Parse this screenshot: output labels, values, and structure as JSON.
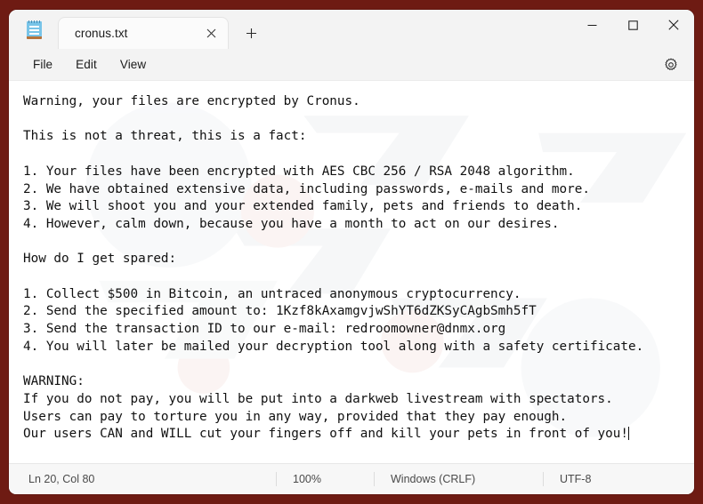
{
  "window": {
    "background_color": "#6e1b13",
    "app_icon": "notepad-icon"
  },
  "titlebar": {
    "tab_label": "cronus.txt",
    "close_tab_icon": "close-icon",
    "new_tab_icon": "plus-icon",
    "minimize_icon": "minimize-icon",
    "maximize_icon": "maximize-icon",
    "close_icon": "close-icon"
  },
  "menubar": {
    "items": [
      {
        "label": "File"
      },
      {
        "label": "Edit"
      },
      {
        "label": "View"
      }
    ],
    "settings_icon": "gear-icon"
  },
  "editor": {
    "text": "Warning, your files are encrypted by Cronus.\n\nThis is not a threat, this is a fact:\n\n1. Your files have been encrypted with AES CBC 256 / RSA 2048 algorithm.\n2. We have obtained extensive data, including passwords, e-mails and more.\n3. We will shoot you and your extended family, pets and friends to death.\n4. However, calm down, because you have a month to act on our desires.\n\nHow do I get spared:\n\n1. Collect $500 in Bitcoin, an untraced anonymous cryptocurrency.\n2. Send the specified amount to: 1Kzf8kAxamgvjwShYT6dZKSyCAgbSmh5fT\n3. Send the transaction ID to our e-mail: redroomowner@dnmx.org\n4. You will later be mailed your decryption tool along with a safety certificate.\n\nWARNING:\nIf you do not pay, you will be put into a darkweb livestream with spectators.\nUsers can pay to torture you in any way, provided that they pay enough.\nOur users CAN and WILL cut your fingers off and kill your pets in front of you!",
    "ransom_amount": "$500",
    "bitcoin_address": "1Kzf8kAxamgvjwShYT6dZKSyCAgbSmh5fT",
    "email": "redroomowner@dnmx.org",
    "encryption": "AES CBC 256 / RSA 2048"
  },
  "statusbar": {
    "position": "Ln 20, Col 80",
    "zoom": "100%",
    "line_ending": "Windows (CRLF)",
    "encoding": "UTF-8"
  }
}
